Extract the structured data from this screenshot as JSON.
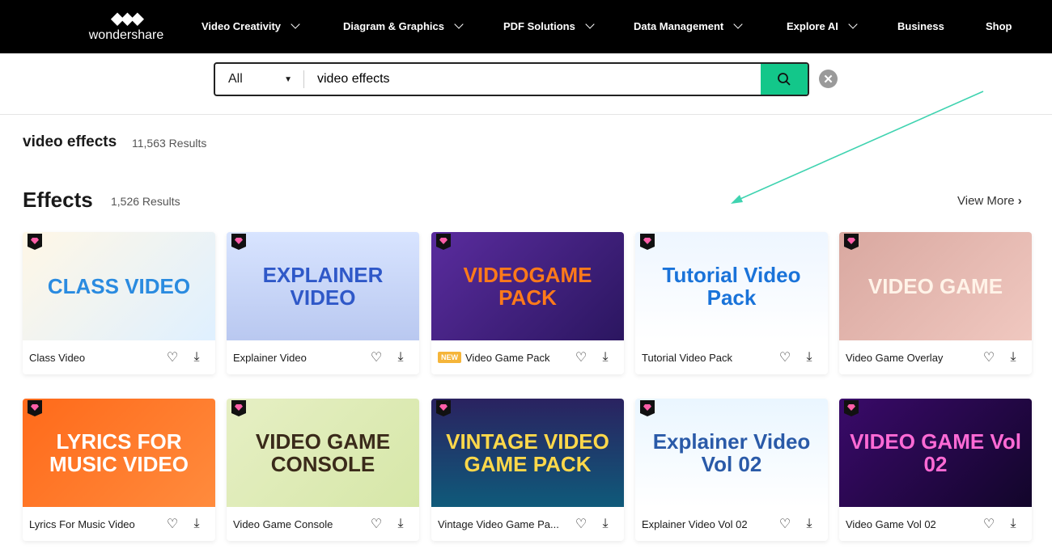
{
  "nav": {
    "logo": "wondershare",
    "items": [
      {
        "label": "Video Creativity",
        "dropdown": true
      },
      {
        "label": "Diagram & Graphics",
        "dropdown": true
      },
      {
        "label": "PDF Solutions",
        "dropdown": true
      },
      {
        "label": "Data Management",
        "dropdown": true
      },
      {
        "label": "Explore AI",
        "dropdown": true
      },
      {
        "label": "Business",
        "dropdown": false
      },
      {
        "label": "Shop",
        "dropdown": false
      }
    ]
  },
  "search": {
    "category": "All",
    "value": "video effects",
    "accent": "#13c78a"
  },
  "query": {
    "title": "video effects",
    "count": "11,563 Results"
  },
  "section": {
    "title": "Effects",
    "count": "1,526 Results",
    "view_more": "View More"
  },
  "cards": [
    {
      "title": "Class Video",
      "art": "CLASS VIDEO",
      "bg": "linear-gradient(135deg,#fff7e6,#dff0ff)",
      "fg": "#2a8be0",
      "new": false
    },
    {
      "title": "Explainer Video",
      "art": "EXPLAINER VIDEO",
      "bg": "linear-gradient(180deg,#d8e4ff,#b9c8f0)",
      "fg": "#2f58c8",
      "new": false
    },
    {
      "title": "Video Game Pack",
      "art": "VIDEOGAME PACK",
      "bg": "linear-gradient(135deg,#5a2c9e,#2b1660)",
      "fg": "#ff7a1a",
      "new": true,
      "new_label": "NEW"
    },
    {
      "title": "Tutorial Video Pack",
      "art": "Tutorial Video Pack",
      "bg": "linear-gradient(180deg,#eef6ff,#ffffff)",
      "fg": "#1a73d9",
      "new": false
    },
    {
      "title": "Video Game Overlay",
      "art": "VIDEO GAME",
      "bg": "linear-gradient(135deg,#d9a8a0,#f0c8c0)",
      "fg": "#fff3e8",
      "new": false
    },
    {
      "title": "Lyrics For Music Video",
      "art": "LYRICS FOR MUSIC VIDEO",
      "bg": "linear-gradient(135deg,#ff6a1a,#ff8b3d)",
      "fg": "#ffffff",
      "new": false
    },
    {
      "title": "Video Game Console",
      "art": "VIDEO GAME CONSOLE",
      "bg": "linear-gradient(135deg,#e6efc4,#d6e7a8)",
      "fg": "#3a2a1a",
      "new": false
    },
    {
      "title": "Vintage Video Game Pa...",
      "art": "VINTAGE VIDEO GAME PACK",
      "bg": "linear-gradient(180deg,#2a2260,#0f5a7a)",
      "fg": "#ffd84a",
      "new": false
    },
    {
      "title": "Explainer Video Vol 02",
      "art": "Explainer Video Vol 02",
      "bg": "linear-gradient(180deg,#eaf6ff,#ffffff)",
      "fg": "#2a5aa8",
      "new": false
    },
    {
      "title": "Video Game Vol 02",
      "art": "VIDEO GAME Vol 02",
      "bg": "linear-gradient(135deg,#3a0a6a,#12052a)",
      "fg": "#ff6ad5",
      "new": false
    }
  ]
}
